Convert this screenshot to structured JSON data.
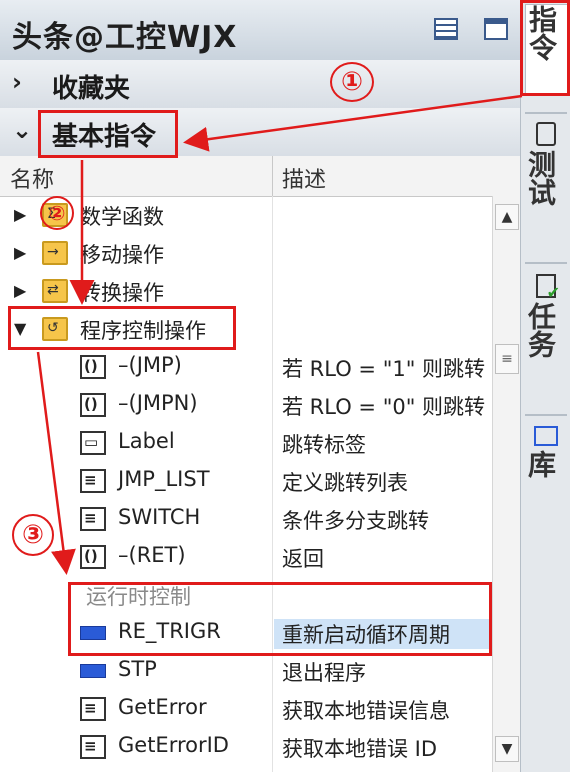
{
  "title": "头条@工控WJX",
  "sections": {
    "favorites": {
      "chevron": "›",
      "label": "收藏夹"
    },
    "basic": {
      "chevron": "⌄",
      "label": "基本指令"
    }
  },
  "columns": {
    "name": "名称",
    "desc": "描述"
  },
  "rows": [
    {
      "name": "数学函数",
      "desc": "",
      "icon": "folder-icon"
    },
    {
      "name": "移动操作",
      "desc": "",
      "icon": "folder-icon"
    },
    {
      "name": "转换操作",
      "desc": "",
      "icon": "folder-icon"
    },
    {
      "name": "程序控制操作",
      "desc": "",
      "icon": "folder-icon"
    },
    {
      "name": "–(JMP)",
      "desc": "若 RLO = \"1\" 则跳转",
      "icon": "jump-icon"
    },
    {
      "name": "–(JMPN)",
      "desc": "若 RLO = \"0\" 则跳转",
      "icon": "jump-icon"
    },
    {
      "name": "Label",
      "desc": "跳转标签",
      "icon": "label-icon"
    },
    {
      "name": "JMP_LIST",
      "desc": "定义跳转列表",
      "icon": "box-icon"
    },
    {
      "name": "SWITCH",
      "desc": "条件多分支跳转",
      "icon": "box-icon"
    },
    {
      "name": "–(RET)",
      "desc": "返回",
      "icon": "jump-icon"
    },
    {
      "name": "运行时控制",
      "desc": "",
      "icon": ""
    },
    {
      "name": "RE_TRIGR",
      "desc": "重新启动循环周期",
      "icon": "coil-icon"
    },
    {
      "name": "STP",
      "desc": "退出程序",
      "icon": "coil-icon"
    },
    {
      "name": "GetError",
      "desc": "获取本地错误信息",
      "icon": "box-icon"
    },
    {
      "name": "GetErrorID",
      "desc": "获取本地错误 ID",
      "icon": "box-icon"
    }
  ],
  "right_tabs": {
    "instructions": "指令",
    "testing": "测试",
    "tasks": "任务",
    "library": "库"
  },
  "annotations": {
    "one": "①",
    "two": "②",
    "three": "③"
  },
  "colors": {
    "highlight": "#e01b1b",
    "selection": "#cfe3f7",
    "coil": "#2a5bd7",
    "folder": "#f6c54a"
  }
}
